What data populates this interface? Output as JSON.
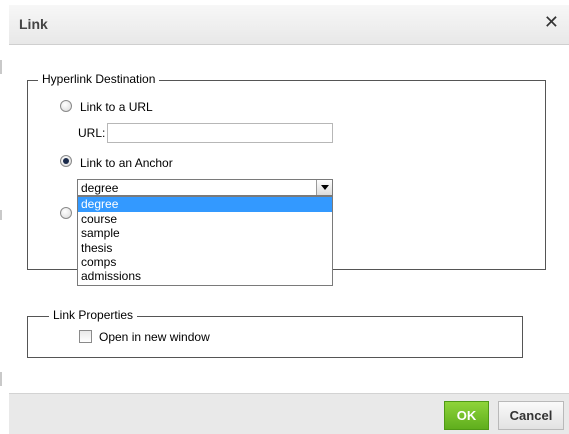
{
  "dialog": {
    "title": "Link",
    "close_icon": "close-icon"
  },
  "destination": {
    "legend": "Hyperlink Destination",
    "options": [
      {
        "label": "Link to a URL",
        "checked": false
      },
      {
        "label": "Link to an Anchor",
        "checked": true
      }
    ],
    "url_label": "URL:",
    "url_value": "",
    "anchor_selected": "degree",
    "anchor_options": [
      "degree",
      "course",
      "sample",
      "thesis",
      "comps",
      "admissions"
    ]
  },
  "properties": {
    "legend": "Link Properties",
    "open_new_window_label": "Open in new window",
    "open_new_window_checked": false
  },
  "buttons": {
    "ok": "OK",
    "cancel": "Cancel"
  },
  "colors": {
    "ok_green": "#6dbb25",
    "selection_blue": "#3399ff"
  }
}
